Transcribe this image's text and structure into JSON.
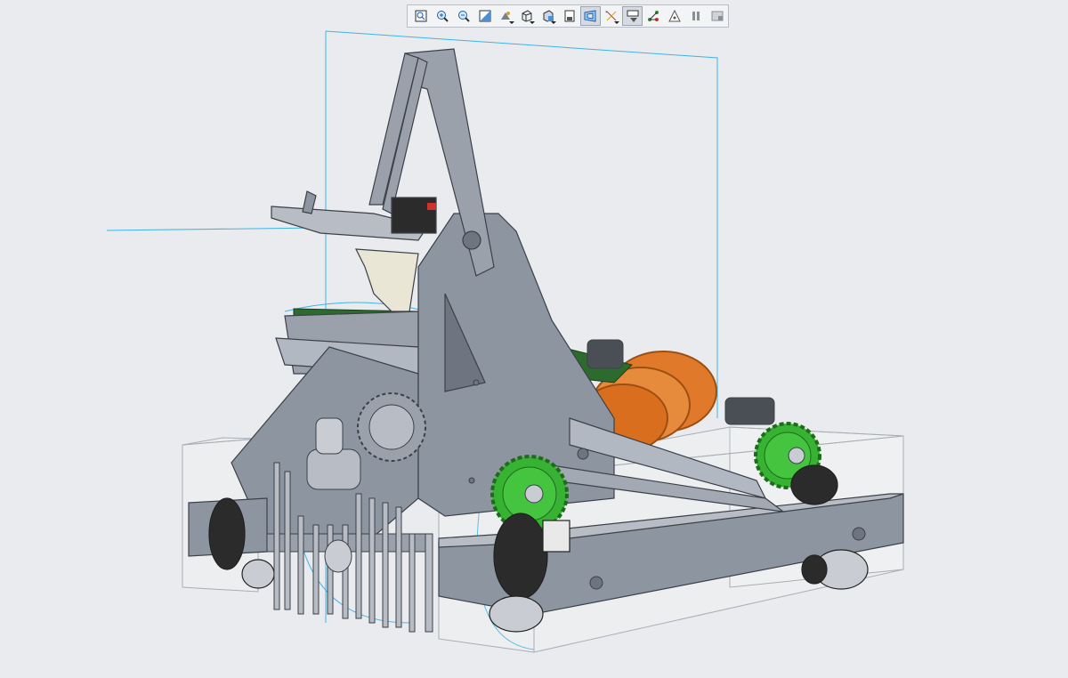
{
  "app": {
    "name": ""
  },
  "toolbar": {
    "buttons": [
      {
        "id": "refit",
        "icon": "refit-icon",
        "active": false
      },
      {
        "id": "zoom-in",
        "icon": "zoom-in-icon",
        "active": false
      },
      {
        "id": "zoom-out",
        "icon": "zoom-out-icon",
        "active": false
      },
      {
        "id": "repaint",
        "icon": "repaint-icon",
        "active": false
      },
      {
        "id": "display-style",
        "icon": "display-style-icon",
        "active": false,
        "has_menu": true
      },
      {
        "id": "saved-orientations",
        "icon": "saved-orientations-icon",
        "active": false,
        "has_menu": true
      },
      {
        "id": "named-views",
        "icon": "named-views-icon",
        "active": false,
        "has_menu": true
      },
      {
        "id": "view-manager",
        "icon": "view-manager-icon",
        "active": false
      },
      {
        "id": "perspective",
        "icon": "perspective-view-icon",
        "active": true
      },
      {
        "id": "datum-display",
        "icon": "datum-display-icon",
        "active": false,
        "has_menu": true
      },
      {
        "id": "section",
        "icon": "section-icon",
        "active": true
      },
      {
        "id": "annotation-display",
        "icon": "annotation-display-icon",
        "active": false
      },
      {
        "id": "spin-center",
        "icon": "spin-center-icon",
        "active": false
      },
      {
        "id": "pause",
        "icon": "pause-icon",
        "active": false
      },
      {
        "id": "appearance",
        "icon": "appearance-gallery-icon",
        "active": false
      }
    ]
  },
  "model": {
    "description_visible": false,
    "colors": {
      "background": "#e9ebee",
      "metal": "#8d95a0",
      "gear_green": "#37b233",
      "sprocket_orange": "#e07a2a",
      "datum_plane": "#3fb4e6",
      "bounding_box": "#a9aeb4",
      "pcb_green": "#2d6a2d"
    }
  }
}
